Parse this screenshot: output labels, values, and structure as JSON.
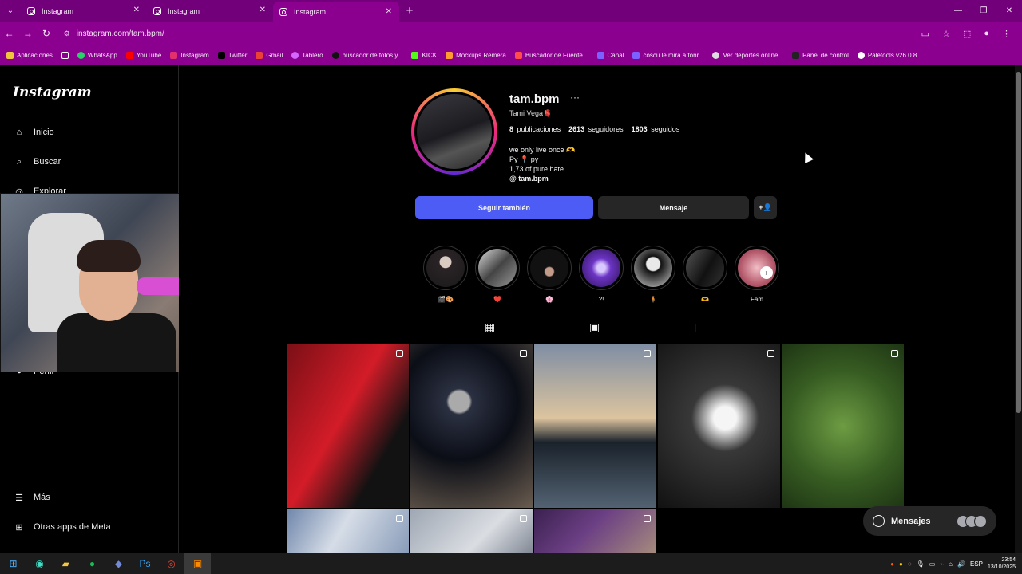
{
  "browser": {
    "tabs": [
      {
        "title": "Instagram"
      },
      {
        "title": "Instagram"
      },
      {
        "title": "Instagram"
      }
    ],
    "new_tab": "+",
    "url": "instagram.com/tam.bpm/",
    "bookmarks": [
      "Aplicaciones",
      "WhatsApp",
      "YouTube",
      "Instagram",
      "Twitter",
      "Gmail",
      "Tablero",
      "buscador de fotos y...",
      "KICK",
      "Mockups Remera",
      "Buscador de Fuente...",
      "Canal",
      "coscu le mira a tonr...",
      "Ver deportes online...",
      "Panel de control",
      "Paletools v26.0.8"
    ],
    "colors": {
      "chrome": "#8b008f",
      "tab_strip": "#72007a"
    }
  },
  "sidebar": {
    "logo": "Instagram",
    "items": [
      {
        "label": "Inicio",
        "icon": "home-icon"
      },
      {
        "label": "Buscar",
        "icon": "search-icon"
      },
      {
        "label": "Explorar",
        "icon": "compass-icon"
      },
      {
        "label": "Más",
        "icon": "menu-icon"
      },
      {
        "label": "Otras apps de Meta",
        "icon": "apps-icon"
      }
    ],
    "partial_item": "Perfil"
  },
  "profile": {
    "username": "tam.bpm",
    "more": "···",
    "full_name": "Tami Vega🫀",
    "stats": [
      {
        "value": "8",
        "label": "publicaciones"
      },
      {
        "value": "2613",
        "label": "seguidores"
      },
      {
        "value": "1803",
        "label": "seguidos"
      }
    ],
    "bio": [
      "we only live once 🫶",
      "Py 📍 py",
      "1,73 of pure hate"
    ],
    "link": "tam.bpm",
    "buttons": {
      "follow_back": "Seguir también",
      "message": "Mensaje",
      "add_user": "+👤"
    },
    "highlights": [
      {
        "label": "🎬🎨"
      },
      {
        "label": "❤️"
      },
      {
        "label": "🌸"
      },
      {
        "label": "?!"
      },
      {
        "label": "🧍"
      },
      {
        "label": "🫶"
      },
      {
        "label": "Fam"
      }
    ],
    "accent": "#4c5cf5"
  },
  "messages_widget": {
    "label": "Mensajes"
  },
  "taskbar": {
    "lang": "ESP",
    "time": "23:54",
    "date": "13/10/2025"
  }
}
